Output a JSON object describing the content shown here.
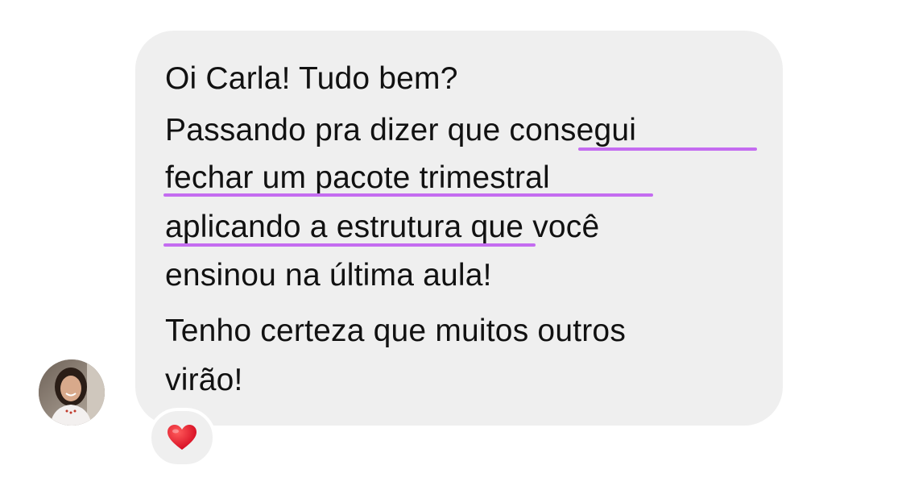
{
  "message": {
    "lines": [
      "Oi Carla! Tudo bem?",
      "Passando pra dizer que",
      "consegui",
      "fechar um pacote trimestral",
      "aplicando a estrutura",
      "que você",
      "ensinou na última aula!",
      "Tenho certeza que muitos outros",
      "virão!"
    ]
  },
  "reaction": {
    "icon": "heart-icon",
    "emoji": "❤️"
  },
  "colors": {
    "bubble": "#efefef",
    "highlight_underline": "#c46cf0",
    "text": "#111111"
  }
}
